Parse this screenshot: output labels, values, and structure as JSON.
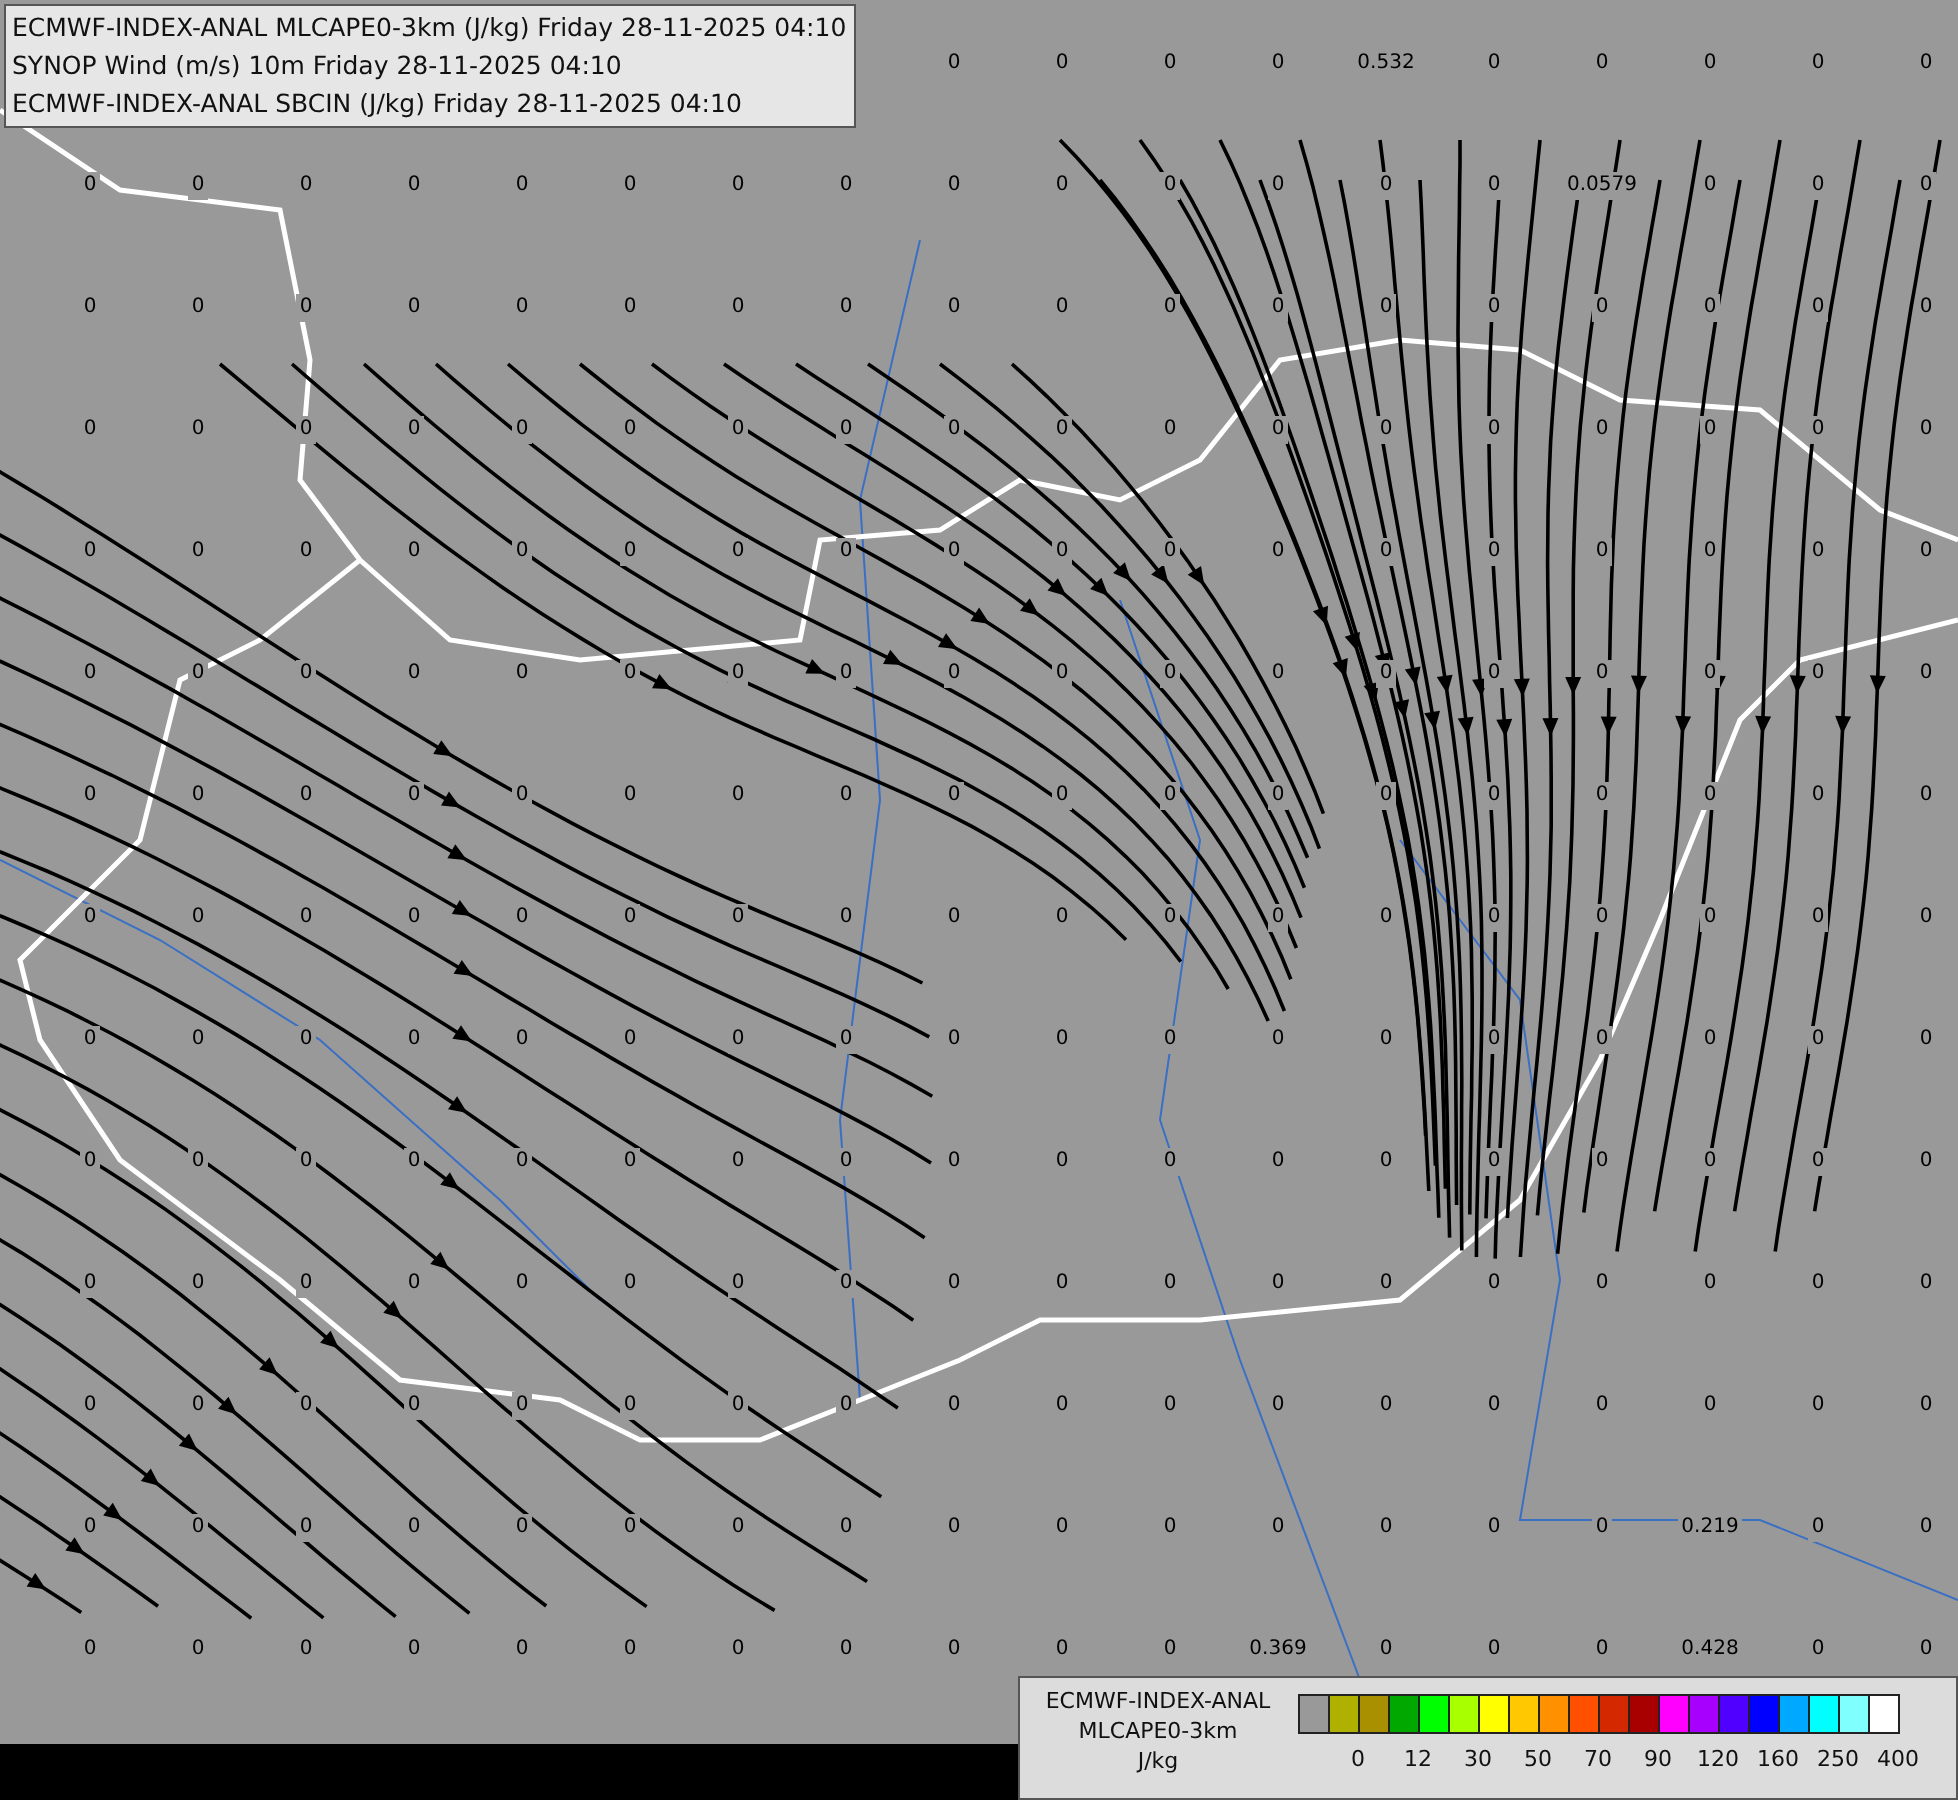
{
  "header": {
    "lines": [
      "ECMWF-INDEX-ANAL MLCAPE0-3km (J/kg) Friday 28-11-2025 04:10",
      "SYNOP Wind (m/s) 10m Friday 28-11-2025 04:10",
      "ECMWF-INDEX-ANAL SBCIN (J/kg) Friday 28-11-2025 04:10"
    ]
  },
  "grid_values": [
    [
      "0",
      "0",
      "0",
      "0",
      "0.532",
      "0",
      "0",
      "0",
      "0",
      "0"
    ],
    [
      "0",
      "0",
      "0",
      "0",
      "0",
      "0",
      "0",
      "0",
      "0",
      "0",
      "0",
      "0",
      "0",
      "0",
      "0.0579",
      "0",
      "0",
      "0"
    ],
    [
      "0",
      "0",
      "0",
      "0",
      "0",
      "0",
      "0",
      "0",
      "0",
      "0",
      "0",
      "0",
      "0",
      "0",
      "0",
      "0",
      "0",
      "0"
    ],
    [
      "0",
      "0",
      "0",
      "0",
      "0",
      "0",
      "0",
      "0",
      "0",
      "0",
      "0",
      "0",
      "0",
      "0",
      "0",
      "0",
      "0",
      "0"
    ],
    [
      "0",
      "0",
      "0",
      "0",
      "0",
      "0",
      "0",
      "0",
      "0",
      "0",
      "0",
      "0",
      "0",
      "0",
      "0",
      "0",
      "0",
      "0"
    ],
    [
      "0",
      "0",
      "0",
      "0",
      "0",
      "0",
      "0",
      "0",
      "0",
      "0",
      "0",
      "0",
      "0",
      "0",
      "0",
      "0",
      "0",
      "0"
    ],
    [
      "0",
      "0",
      "0",
      "0",
      "0",
      "0",
      "0",
      "0",
      "0",
      "0",
      "0",
      "0",
      "0",
      "0",
      "0",
      "0",
      "0",
      "0"
    ],
    [
      "0",
      "0",
      "0",
      "0",
      "0",
      "0",
      "0",
      "0",
      "0",
      "0",
      "0",
      "0",
      "0",
      "0",
      "0",
      "0",
      "0",
      "0"
    ],
    [
      "0",
      "0",
      "0",
      "0",
      "0",
      "0",
      "0",
      "0",
      "0",
      "0",
      "0",
      "0",
      "0",
      "0",
      "0",
      "0",
      "0",
      "0"
    ],
    [
      "0",
      "0",
      "0",
      "0",
      "0",
      "0",
      "0",
      "0",
      "0",
      "0",
      "0",
      "0",
      "0",
      "0",
      "0",
      "0",
      "0",
      "0"
    ],
    [
      "0",
      "0",
      "0",
      "0",
      "0",
      "0",
      "0",
      "0",
      "0",
      "0",
      "0",
      "0",
      "0",
      "0",
      "0",
      "0",
      "0",
      "0"
    ],
    [
      "0",
      "0",
      "0",
      "0",
      "0",
      "0",
      "0",
      "0",
      "0",
      "0",
      "0",
      "0",
      "0",
      "0",
      "0",
      "0",
      "0",
      "0"
    ],
    [
      "0",
      "0",
      "0",
      "0",
      "0",
      "0",
      "0",
      "0",
      "0",
      "0",
      "0",
      "0",
      "0",
      "0",
      "0",
      "0.219",
      "0",
      "0"
    ],
    [
      "0",
      "0",
      "0",
      "0",
      "0",
      "0",
      "0",
      "0",
      "0",
      "0",
      "0",
      "0.369",
      "0",
      "0",
      "0",
      "0.428",
      "0",
      "0"
    ]
  ],
  "legend": {
    "title_lines": [
      "ECMWF-INDEX-ANAL",
      "MLCAPE0-3km"
    ],
    "unit": "J/kg",
    "swatches": [
      {
        "color": "#999999"
      },
      {
        "color": "#b0b000"
      },
      {
        "color": "#a89000"
      },
      {
        "color": "#00a800"
      },
      {
        "color": "#00ff00"
      },
      {
        "color": "#a8ff00"
      },
      {
        "color": "#ffff00"
      },
      {
        "color": "#ffc800"
      },
      {
        "color": "#ff9000"
      },
      {
        "color": "#ff5000"
      },
      {
        "color": "#d42800"
      },
      {
        "color": "#a80000"
      },
      {
        "color": "#ff00ff"
      },
      {
        "color": "#a800ff"
      },
      {
        "color": "#5000ff"
      },
      {
        "color": "#0000ff"
      },
      {
        "color": "#00a8ff"
      },
      {
        "color": "#00ffff"
      },
      {
        "color": "#80ffff"
      },
      {
        "color": "#ffffff"
      }
    ],
    "ticks": [
      "0",
      "12",
      "30",
      "50",
      "70",
      "90",
      "120",
      "160",
      "250",
      "400"
    ]
  }
}
